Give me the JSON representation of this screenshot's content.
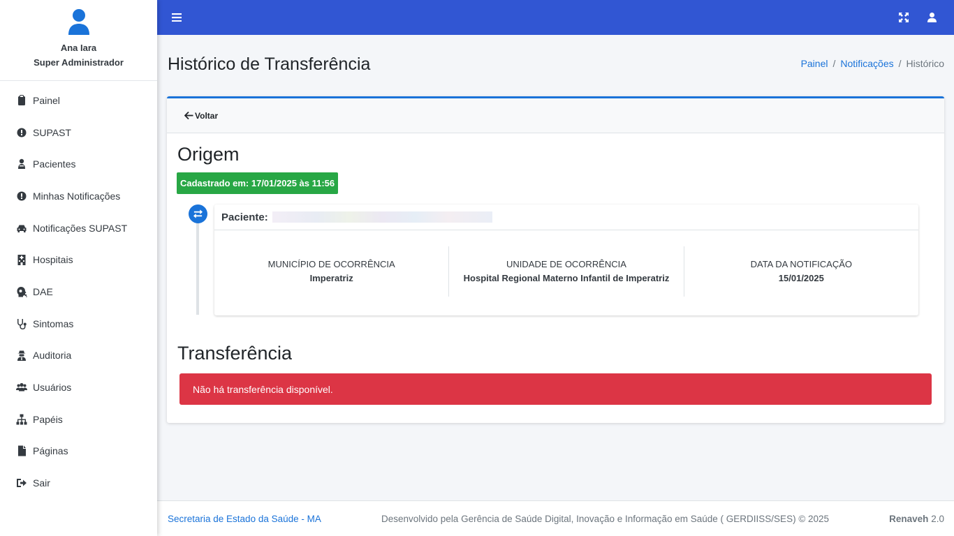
{
  "user": {
    "name": "Ana Iara",
    "role": "Super Administrador"
  },
  "sidebar": {
    "items": [
      {
        "label": "Painel",
        "icon": "clipboard-icon"
      },
      {
        "label": "SUPAST",
        "icon": "exclamation-circle-icon"
      },
      {
        "label": "Pacientes",
        "icon": "user-injured-icon"
      },
      {
        "label": "Minhas Notificações",
        "icon": "exclamation-circle-icon"
      },
      {
        "label": "Notificações SUPAST",
        "icon": "car-icon"
      },
      {
        "label": "Hospitais",
        "icon": "hospital-icon"
      },
      {
        "label": "DAE",
        "icon": "head-virus-icon"
      },
      {
        "label": "Sintomas",
        "icon": "stethoscope-icon"
      },
      {
        "label": "Auditoria",
        "icon": "user-secret-icon"
      },
      {
        "label": "Usuários",
        "icon": "users-icon"
      },
      {
        "label": "Papéis",
        "icon": "sitemap-icon"
      },
      {
        "label": "Páginas",
        "icon": "file-icon"
      },
      {
        "label": "Sair",
        "icon": "sign-out-icon"
      }
    ]
  },
  "topbar": {
    "menu_icon": "hamburger-icon",
    "fullscreen_icon": "expand-icon",
    "user_icon": "user-icon",
    "color": "#3156d3"
  },
  "header": {
    "title": "Histórico de Transferência",
    "breadcrumb": [
      "Painel",
      "Notificações",
      "Histórico"
    ]
  },
  "card": {
    "back_label": "Voltar",
    "origin_title": "Origem",
    "registered_badge": "Cadastrado em: 17/01/2025 às 11:56",
    "patient_label": "Paciente:",
    "stats": [
      {
        "label": "MUNICÍPIO DE OCORRÊNCIA",
        "value": "Imperatriz"
      },
      {
        "label": "UNIDADE DE OCORRÊNCIA",
        "value": "Hospital Regional Materno Infantil de Imperatriz"
      },
      {
        "label": "DATA DA NOTIFICAÇÃO",
        "value": "15/01/2025"
      }
    ],
    "transfer_title": "Transferência",
    "transfer_alert": "Não há transferência disponível."
  },
  "footer": {
    "left_link": "Secretaria de Estado da Saúde - MA",
    "center": "Desenvolvido pela Gerência de Saúde Digital, Inovação e Informação em Saúde ( GERDIISS/SES) © 2025",
    "brand": "Renaveh",
    "version": "2.0"
  },
  "colors": {
    "accent": "#1a73d9",
    "success": "#28a745",
    "danger": "#dc3545"
  }
}
